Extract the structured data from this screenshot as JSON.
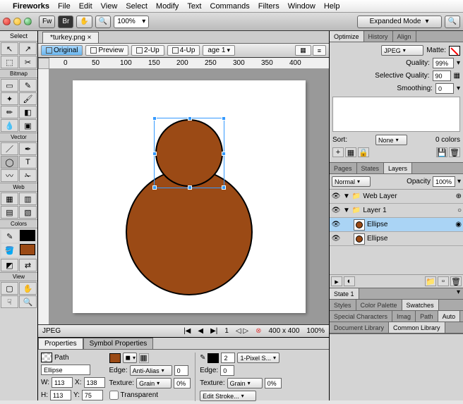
{
  "menubar": {
    "app": "Fireworks",
    "items": [
      "File",
      "Edit",
      "View",
      "Select",
      "Modify",
      "Text",
      "Commands",
      "Filters",
      "Window",
      "Help"
    ]
  },
  "toolbar": {
    "fw": "Fw",
    "br": "Br",
    "zoom": "100%",
    "mode_label": "Expanded Mode"
  },
  "document": {
    "title": "*turkey.png"
  },
  "viewbar": {
    "original": "Original",
    "preview": "Preview",
    "twoup": "2-Up",
    "fourup": "4-Up",
    "page": "age 1"
  },
  "statusbar": {
    "format": "JPEG",
    "dims": "400 x 400",
    "zoom": "100%"
  },
  "canvas": {
    "big_fill": "#9b4a15",
    "small_fill": "#9b4a15"
  },
  "toolpanel": {
    "select": "Select",
    "bitmap": "Bitmap",
    "vector": "Vector",
    "web": "Web",
    "colors": "Colors",
    "view": "View"
  },
  "optimize": {
    "tabs": [
      "Optimize",
      "History",
      "Align"
    ],
    "format": "JPEG",
    "matte": "Matte:",
    "quality_l": "Quality:",
    "quality_v": "99%",
    "selq_l": "Selective Quality:",
    "selq_v": "90",
    "smooth_l": "Smoothing:",
    "smooth_v": "0",
    "sort_l": "Sort:",
    "sort_v": "None",
    "colors": "0 colors"
  },
  "layers": {
    "tabs": [
      "Pages",
      "States",
      "Layers"
    ],
    "blend": "Normal",
    "opacity_l": "Opacity",
    "opacity_v": "100%",
    "weblayer": "Web Layer",
    "layer1": "Layer 1",
    "ellipse": "Ellipse"
  },
  "bottomtabs": {
    "row1": [
      "State 1"
    ],
    "row2": [
      "Styles",
      "Color Palette",
      "Swatches"
    ],
    "row3": [
      "Special Characters",
      "Imag",
      "Path",
      "Auto"
    ],
    "row4": [
      "Document Library",
      "Common Library"
    ]
  },
  "props": {
    "tabs": [
      "Properties",
      "Symbol Properties"
    ],
    "path_l": "Path",
    "name": "Ellipse",
    "w_l": "W:",
    "w_v": "113",
    "x_l": "X:",
    "x_v": "138",
    "h_l": "H:",
    "h_v": "113",
    "y_l": "Y:",
    "y_v": "75",
    "edge_l": "Edge:",
    "edge_v": "Anti-Alias",
    "edge_n": "0",
    "texture_l": "Texture:",
    "texture_v": "Grain",
    "texture_p": "0%",
    "transparent": "Transparent",
    "stroke_w": "2",
    "stroke_cat": "1-Pixel S...",
    "s_edge_n": "0",
    "s_texture_v": "Grain",
    "s_texture_p": "0%",
    "editstroke": "Edit Stroke..."
  }
}
